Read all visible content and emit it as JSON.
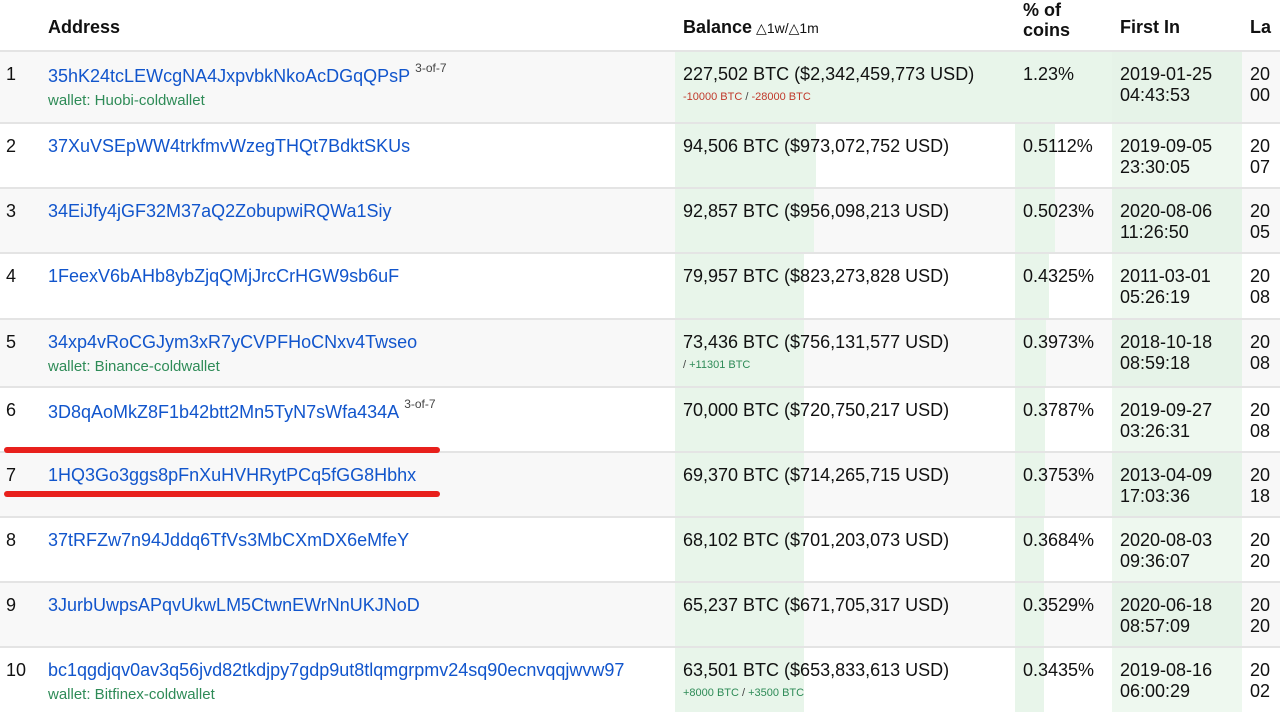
{
  "header": {
    "address": "Address",
    "balance": "Balance",
    "balance_delta": "△1w/△1m",
    "pct_line1": "% of",
    "pct_line2": "coins",
    "first_in": "First In",
    "last_in": "La"
  },
  "rows": [
    {
      "rank": "1",
      "address": "35hK24tcLEWcgNA4JxpvbkNkoAcDGqQPsP",
      "sig": "3-of-7",
      "wallet": "wallet: Huobi-coldwallet",
      "balance": "227,502 BTC ($2,342,459,773 USD)",
      "d1w": "-10000 BTC",
      "sep": " / ",
      "d1m": "-28000 BTC",
      "pct": "1.23%",
      "first_date": "2019-01-25",
      "first_time": "04:43:53",
      "last_a": "20",
      "last_b": "00",
      "bar": 1.0
    },
    {
      "rank": "2",
      "address": "37XuVSEpWW4trkfmvWzegTHQt7BdktSKUs",
      "sig": "",
      "wallet": "",
      "balance": "94,506 BTC ($973,072,752 USD)",
      "d1w": "",
      "sep": "",
      "d1m": "",
      "pct": "0.5112%",
      "first_date": "2019-09-05",
      "first_time": "23:30:05",
      "last_a": "20",
      "last_b": "07",
      "bar": 0.415
    },
    {
      "rank": "3",
      "address": "34EiJfy4jGF32M37aQ2ZobupwiRQWa1Siy",
      "sig": "",
      "wallet": "",
      "balance": "92,857 BTC ($956,098,213 USD)",
      "d1w": "",
      "sep": "",
      "d1m": "",
      "pct": "0.5023%",
      "first_date": "2020-08-06",
      "first_time": "11:26:50",
      "last_a": "20",
      "last_b": "05",
      "bar": 0.408
    },
    {
      "rank": "4",
      "address": "1FeexV6bAHb8ybZjqQMjJrcCrHGW9sb6uF",
      "sig": "",
      "wallet": "",
      "balance": "79,957 BTC ($823,273,828 USD)",
      "d1w": "",
      "sep": "",
      "d1m": "",
      "pct": "0.4325%",
      "first_date": "2011-03-01",
      "first_time": "05:26:19",
      "last_a": "20",
      "last_b": "08",
      "bar": 0.351
    },
    {
      "rank": "5",
      "address": "34xp4vRoCGJym3xR7yCVPFHoCNxv4Twseo",
      "sig": "",
      "wallet": "wallet: Binance-coldwallet",
      "balance": "73,436 BTC ($756,131,577 USD)",
      "d1w": "",
      "sep": "/ ",
      "d1m": "+11301 BTC",
      "pct": "0.3973%",
      "first_date": "2018-10-18",
      "first_time": "08:59:18",
      "last_a": "20",
      "last_b": "08",
      "bar": 0.323
    },
    {
      "rank": "6",
      "address": "3D8qAoMkZ8F1b42btt2Mn5TyN7sWfa434A",
      "sig": "3-of-7",
      "wallet": "",
      "balance": "70,000 BTC ($720,750,217 USD)",
      "d1w": "",
      "sep": "",
      "d1m": "",
      "pct": "0.3787%",
      "first_date": "2019-09-27",
      "first_time": "03:26:31",
      "last_a": "20",
      "last_b": "08",
      "bar": 0.308
    },
    {
      "rank": "7",
      "address": "1HQ3Go3ggs8pFnXuHVHRytPCq5fGG8Hbhx",
      "sig": "",
      "wallet": "",
      "balance": "69,370 BTC ($714,265,715 USD)",
      "d1w": "",
      "sep": "",
      "d1m": "",
      "pct": "0.3753%",
      "first_date": "2013-04-09",
      "first_time": "17:03:36",
      "last_a": "20",
      "last_b": "18",
      "bar": 0.305
    },
    {
      "rank": "8",
      "address": "37tRFZw7n94Jddq6TfVs3MbCXmDX6eMfeY",
      "sig": "",
      "wallet": "",
      "balance": "68,102 BTC ($701,203,073 USD)",
      "d1w": "",
      "sep": "",
      "d1m": "",
      "pct": "0.3684%",
      "first_date": "2020-08-03",
      "first_time": "09:36:07",
      "last_a": "20",
      "last_b": "20",
      "bar": 0.299
    },
    {
      "rank": "9",
      "address": "3JurbUwpsAPqvUkwLM5CtwnEWrNnUKJNoD",
      "sig": "",
      "wallet": "",
      "balance": "65,237 BTC ($671,705,317 USD)",
      "d1w": "",
      "sep": "",
      "d1m": "",
      "pct": "0.3529%",
      "first_date": "2020-06-18",
      "first_time": "08:57:09",
      "last_a": "20",
      "last_b": "20",
      "bar": 0.287
    },
    {
      "rank": "10",
      "address": "bc1qgdjqv0av3q56jvd82tkdjpy7gdp9ut8tlqmgrpmv24sq90ecnvqqjwvw97",
      "sig": "",
      "wallet": "wallet: Bitfinex-coldwallet",
      "balance": "63,501 BTC ($653,833,613 USD)",
      "d1w": "+8000 BTC",
      "sep": " / ",
      "d1m": "+3500 BTC",
      "pct": "0.3435%",
      "first_date": "2019-08-16",
      "first_time": "06:00:29",
      "last_a": "20",
      "last_b": "02",
      "bar": 0.279
    }
  ],
  "annotation_color": "#e8201c"
}
